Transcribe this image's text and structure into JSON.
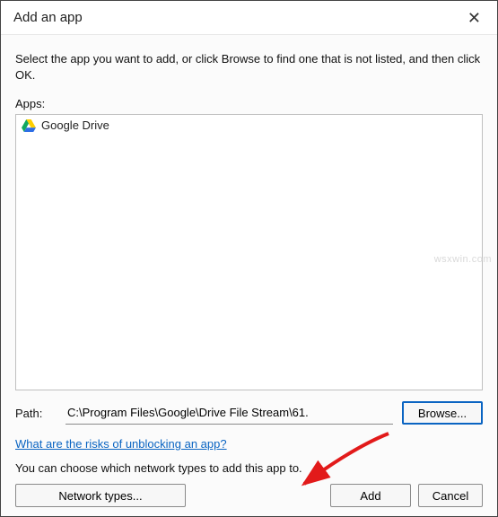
{
  "window": {
    "title": "Add an app"
  },
  "instructions": "Select the app you want to add, or click Browse to find one that is not listed, and then click OK.",
  "apps": {
    "label": "Apps:",
    "items": [
      {
        "name": "Google Drive",
        "icon": "google-drive-icon"
      }
    ]
  },
  "path": {
    "label": "Path:",
    "value": "C:\\Program Files\\Google\\Drive File Stream\\61.",
    "browse_label": "Browse..."
  },
  "risks_link": "What are the risks of unblocking an app?",
  "network_note": "You can choose which network types to add this app to.",
  "buttons": {
    "network_types": "Network types...",
    "add": "Add",
    "cancel": "Cancel"
  },
  "colors": {
    "accent": "#0a64c2",
    "arrow": "#e21a1a"
  },
  "watermark": "wsxwin.com"
}
